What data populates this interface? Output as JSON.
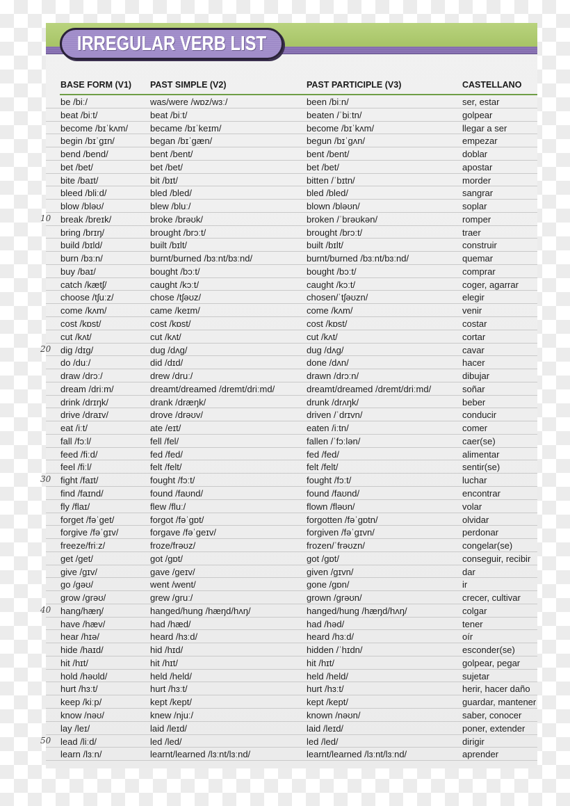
{
  "title": "IRREGULAR VERB LIST",
  "columns": [
    "BASE FORM (V1)",
    "PAST SIMPLE (V2)",
    "PAST PARTICIPLE (V3)",
    "CASTELLANO"
  ],
  "colors": {
    "banner_green": "#b0cc72",
    "banner_purple": "#8f79b8",
    "header_rule": "#6e9e45"
  },
  "rows": [
    {
      "v1": "be /biː/",
      "v2": "was/were /wɒz/wɜː/",
      "v3": "been /biːn/",
      "es": "ser, estar"
    },
    {
      "v1": "beat /biːt/",
      "v2": "beat /biːt/",
      "v3": "beaten /ˈbiːtn/",
      "es": "golpear"
    },
    {
      "v1": "become /bɪˈkʌm/",
      "v2": "became /bɪˈkeɪm/",
      "v3": "become /bɪˈkʌm/",
      "es": "llegar a ser"
    },
    {
      "v1": "begin /bɪˈgɪn/",
      "v2": "began /bɪˈgæn/",
      "v3": "begun /bɪˈgʌn/",
      "es": "empezar"
    },
    {
      "v1": "bend /bend/",
      "v2": "bent /bent/",
      "v3": "bent /bent/",
      "es": "doblar"
    },
    {
      "v1": "bet /bet/",
      "v2": "bet /bet/",
      "v3": "bet /bet/",
      "es": "apostar"
    },
    {
      "v1": "bite /baɪt/",
      "v2": "bit /bɪt/",
      "v3": "bitten /ˈbɪtn/",
      "es": "morder"
    },
    {
      "v1": "bleed /bliːd/",
      "v2": "bled /bled/",
      "v3": "bled /bled/",
      "es": "sangrar"
    },
    {
      "v1": "blow /bləʊ/",
      "v2": "blew /bluː/",
      "v3": "blown /bləʊn/",
      "es": "soplar"
    },
    {
      "v1": "break /breɪk/",
      "v2": "broke /brəʊk/",
      "v3": "broken /ˈbrəʊkən/",
      "es": "romper",
      "margin": "10"
    },
    {
      "v1": "bring /brɪŋ/",
      "v2": "brought /brɔːt/",
      "v3": "brought /brɔːt/",
      "es": "traer"
    },
    {
      "v1": "build /bɪld/",
      "v2": "built /bɪlt/",
      "v3": "built /bɪlt/",
      "es": "construir"
    },
    {
      "v1": "burn /bɜːn/",
      "v2": "burnt/burned /bɜːnt/bɜːnd/",
      "v3": "burnt/burned /bɜːnt/bɜːnd/",
      "es": "quemar"
    },
    {
      "v1": "buy /baɪ/",
      "v2": "bought /bɔːt/",
      "v3": "bought /bɔːt/",
      "es": "comprar"
    },
    {
      "v1": "catch /kætʃ/",
      "v2": "caught /kɔːt/",
      "v3": "caught /kɔːt/",
      "es": "coger, agarrar"
    },
    {
      "v1": "choose /tʃuːz/",
      "v2": "chose /tʃəʊz/",
      "v3": "chosen/ˈtʃəʊzn/",
      "es": "elegir"
    },
    {
      "v1": "come /kʌm/",
      "v2": "came /keɪm/",
      "v3": "come /kʌm/",
      "es": "venir"
    },
    {
      "v1": "cost /kɒst/",
      "v2": "cost /kɒst/",
      "v3": "cost /kɒst/",
      "es": "costar"
    },
    {
      "v1": "cut /kʌt/",
      "v2": "cut /kʌt/",
      "v3": "cut /kʌt/",
      "es": "cortar"
    },
    {
      "v1": "dig /dɪg/",
      "v2": "dug /dʌg/",
      "v3": "dug /dʌg/",
      "es": "cavar",
      "margin": "20"
    },
    {
      "v1": "do /duː/",
      "v2": "did /dɪd/",
      "v3": "done /dʌn/",
      "es": "hacer"
    },
    {
      "v1": "draw /drɔː/",
      "v2": "drew /druː/",
      "v3": "drawn /drɔːn/",
      "es": "dibujar"
    },
    {
      "v1": "dream /driːm/",
      "v2": "dreamt/dreamed /dremt/driːmd/",
      "v3": "dreamt/dreamed /dremt/driːmd/",
      "es": "soñar"
    },
    {
      "v1": "drink /drɪŋk/",
      "v2": "drank /dræŋk/",
      "v3": "drunk /drʌŋk/",
      "es": "beber"
    },
    {
      "v1": "drive /draɪv/",
      "v2": "drove /drəʊv/",
      "v3": "driven /ˈdrɪvn/",
      "es": "conducir"
    },
    {
      "v1": "eat /iːt/",
      "v2": "ate /eɪt/",
      "v3": "eaten /iːtn/",
      "es": "comer"
    },
    {
      "v1": "fall /fɔːl/",
      "v2": "fell /fel/",
      "v3": "fallen /ˈfɔːlən/",
      "es": "caer(se)"
    },
    {
      "v1": "feed /fiːd/",
      "v2": "fed /fed/",
      "v3": "fed /fed/",
      "es": "alimentar"
    },
    {
      "v1": "feel /fiːl/",
      "v2": "felt /felt/",
      "v3": "felt /felt/",
      "es": "sentir(se)"
    },
    {
      "v1": "fight /faɪt/",
      "v2": "fought /fɔːt/",
      "v3": "fought /fɔːt/",
      "es": "luchar",
      "margin": "30"
    },
    {
      "v1": "find /faɪnd/",
      "v2": "found /faʊnd/",
      "v3": "found /faʊnd/",
      "es": "encontrar"
    },
    {
      "v1": "fly /flaɪ/",
      "v2": "flew /fluː/",
      "v3": "flown /fləʊn/",
      "es": "volar"
    },
    {
      "v1": "forget /fəˈget/",
      "v2": "forgot /fəˈgɒt/",
      "v3": "forgotten /fəˈgɒtn/",
      "es": "olvidar"
    },
    {
      "v1": "forgive /fəˈgɪv/",
      "v2": "forgave /fəˈgeɪv/",
      "v3": "forgiven /fəˈgɪvn/",
      "es": "perdonar"
    },
    {
      "v1": "freeze/friːz/",
      "v2": "froze/frəʊz/",
      "v3": "frozen/ˈfrəʊzn/",
      "es": "congelar(se)"
    },
    {
      "v1": "get /get/",
      "v2": "got /gɒt/",
      "v3": "got /gɒt/",
      "es": "conseguir, recibir"
    },
    {
      "v1": "give /gɪv/",
      "v2": "gave /geɪv/",
      "v3": "given /gɪvn/",
      "es": "dar"
    },
    {
      "v1": "go /gəʊ/",
      "v2": "went /went/",
      "v3": "gone /gɒn/",
      "es": "ir"
    },
    {
      "v1": "grow /grəʊ/",
      "v2": "grew /gruː/",
      "v3": "grown /grəʊn/",
      "es": "crecer, cultivar"
    },
    {
      "v1": "hang/hæŋ/",
      "v2": "hanged/hung /hæŋd/hʌŋ/",
      "v3": "hanged/hung /hæŋd/hʌŋ/",
      "es": "colgar",
      "margin": "40"
    },
    {
      "v1": "have /hæv/",
      "v2": "had /hæd/",
      "v3": "had /həd/",
      "es": "tener"
    },
    {
      "v1": "hear /hɪə/",
      "v2": "heard /hɜːd/",
      "v3": "heard /hɜːd/",
      "es": "oír"
    },
    {
      "v1": "hide /haɪd/",
      "v2": "hid /hɪd/",
      "v3": "hidden /ˈhɪdn/",
      "es": "esconder(se)"
    },
    {
      "v1": "hit /hɪt/",
      "v2": "hit /hɪt/",
      "v3": "hit /hɪt/",
      "es": "golpear, pegar"
    },
    {
      "v1": "hold /həʊld/",
      "v2": "held /held/",
      "v3": "held /held/",
      "es": "sujetar"
    },
    {
      "v1": "hurt /hɜːt/",
      "v2": "hurt /hɜːt/",
      "v3": "hurt /hɜːt/",
      "es": "herir, hacer daño"
    },
    {
      "v1": "keep /kiːp/",
      "v2": "kept /kept/",
      "v3": "kept /kept/",
      "es": "guardar, mantener"
    },
    {
      "v1": "know /nəʊ/",
      "v2": "knew /njuː/",
      "v3": "known /nəʊn/",
      "es": "saber, conocer"
    },
    {
      "v1": "lay /leɪ/",
      "v2": "laid /leɪd/",
      "v3": "laid /leɪd/",
      "es": "poner, extender"
    },
    {
      "v1": "lead /liːd/",
      "v2": "led /led/",
      "v3": "led /led/",
      "es": "dirigir",
      "margin": "50"
    },
    {
      "v1": "learn /lɜːn/",
      "v2": "learnt/learned /lɜːnt/lɜːnd/",
      "v3": "learnt/learned /lɜːnt/lɜːnd/",
      "es": "aprender"
    }
  ]
}
